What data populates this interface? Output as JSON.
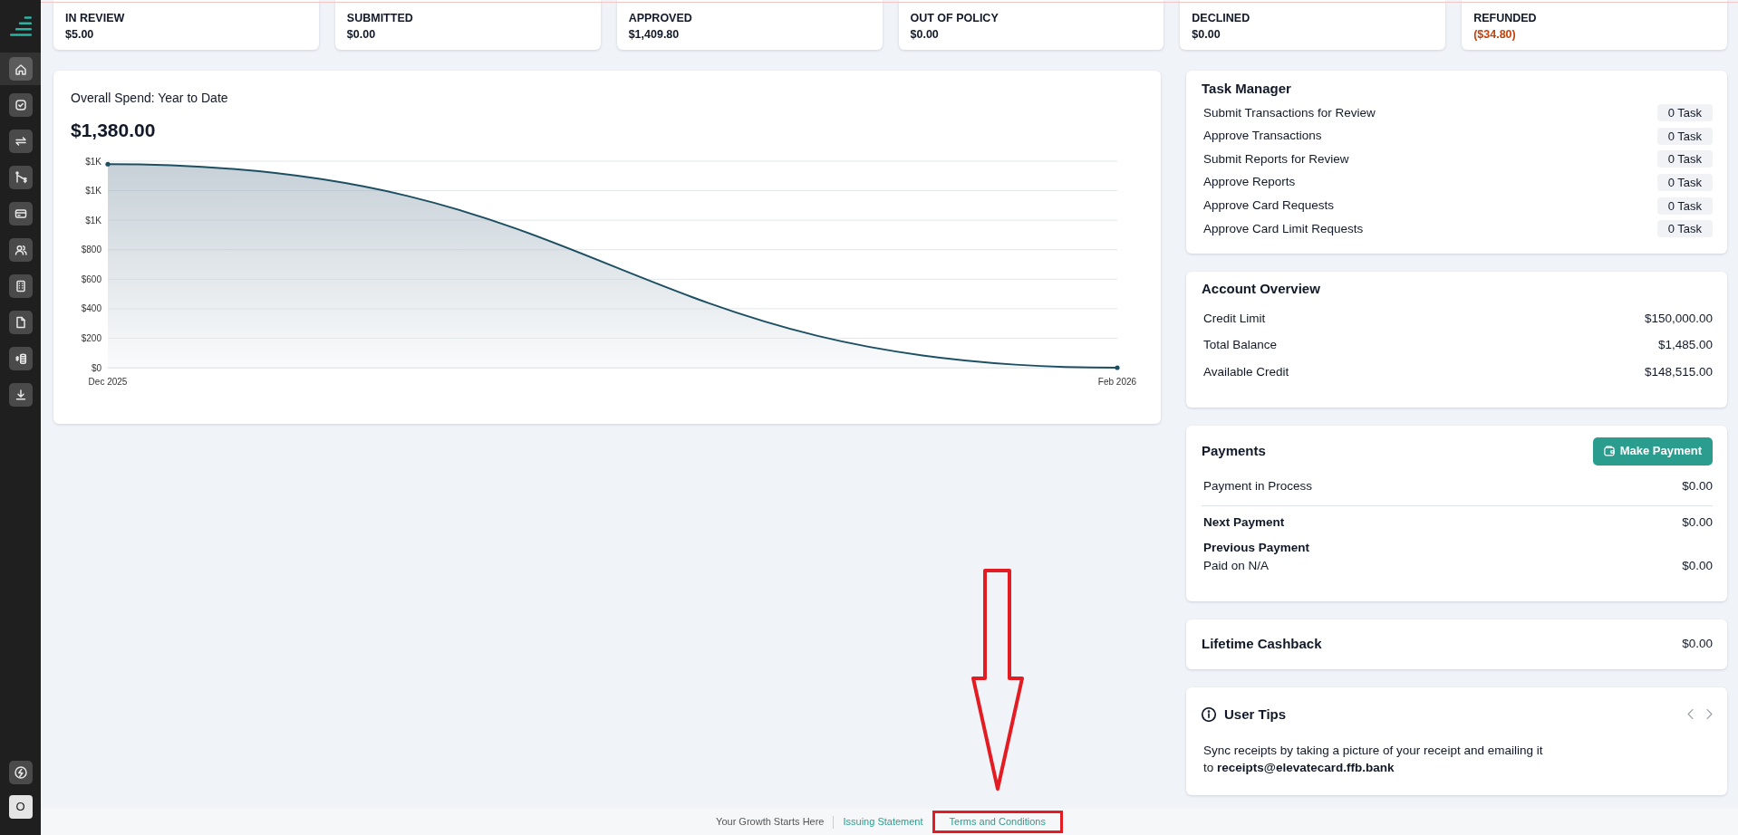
{
  "sidebar": {
    "items": [
      {
        "kind": "home",
        "selected": true
      },
      {
        "kind": "check",
        "selected": false
      },
      {
        "kind": "transfer",
        "selected": false
      },
      {
        "kind": "route",
        "selected": false
      },
      {
        "kind": "card",
        "selected": false
      },
      {
        "kind": "users",
        "selected": false
      },
      {
        "kind": "building",
        "selected": false
      },
      {
        "kind": "file",
        "selected": false
      },
      {
        "kind": "coins",
        "selected": false
      },
      {
        "kind": "download",
        "selected": false
      }
    ],
    "bottom_items": [
      {
        "kind": "bolt"
      }
    ],
    "avatar": {
      "initial": "O"
    }
  },
  "status_cards": [
    {
      "label": "IN REVIEW",
      "amount": "$5.00",
      "negative": false
    },
    {
      "label": "SUBMITTED",
      "amount": "$0.00",
      "negative": false
    },
    {
      "label": "APPROVED",
      "amount": "$1,409.80",
      "negative": false
    },
    {
      "label": "OUT OF POLICY",
      "amount": "$0.00",
      "negative": false
    },
    {
      "label": "DECLINED",
      "amount": "$0.00",
      "negative": false
    },
    {
      "label": "REFUNDED",
      "amount": "($34.80)",
      "negative": true
    }
  ],
  "spend_chart": {
    "title": "Overall Spend: Year to Date",
    "total": "$1,380.00",
    "chart_data": {
      "type": "area",
      "categories": [
        "Dec 2025",
        "Feb 2026"
      ],
      "series": [
        {
          "color": "#1d4f63",
          "values": [
            1380,
            0
          ]
        }
      ],
      "ylim": [
        0,
        1400
      ],
      "yticks": [
        {
          "value": 0,
          "label": "$0"
        },
        {
          "value": 200,
          "label": "$200"
        },
        {
          "value": 400,
          "label": "$400"
        },
        {
          "value": 600,
          "label": "$600"
        },
        {
          "value": 800,
          "label": "$800"
        },
        {
          "value": 1000,
          "label": "$1K"
        },
        {
          "value": 1200,
          "label": "$1K"
        },
        {
          "value": 1400,
          "label": "$1K"
        }
      ]
    }
  },
  "task_manager": {
    "title": "Task Manager",
    "tasks": [
      {
        "label": "Submit Transactions for Review",
        "count": "0 Task"
      },
      {
        "label": "Approve Transactions",
        "count": "0 Task"
      },
      {
        "label": "Submit Reports for Review",
        "count": "0 Task"
      },
      {
        "label": "Approve Reports",
        "count": "0 Task"
      },
      {
        "label": "Approve Card Requests",
        "count": "0 Task"
      },
      {
        "label": "Approve Card Limit Requests",
        "count": "0 Task"
      }
    ]
  },
  "account_overview": {
    "title": "Account Overview",
    "rows": [
      {
        "label": "Credit Limit",
        "value": "$150,000.00"
      },
      {
        "label": "Total Balance",
        "value": "$1,485.00"
      },
      {
        "label": "Available Credit",
        "value": "$148,515.00"
      }
    ]
  },
  "payments": {
    "title": "Payments",
    "button": "Make Payment",
    "rows": [
      {
        "kind": "process",
        "label": "Payment in Process",
        "value": "$0.00"
      },
      {
        "kind": "next",
        "label": "Next Payment",
        "value": "$0.00"
      },
      {
        "kind": "previous",
        "label": "Previous Payment",
        "note": "Paid on N/A",
        "value": "$0.00"
      }
    ]
  },
  "lifetime_cashback": {
    "label": "Lifetime Cashback",
    "value": "$0.00"
  },
  "user_tips": {
    "title": "User Tips",
    "text": "Sync receipts by taking a picture of your receipt and emailing it\nto **receipts@elevatecard.ffb.bank**"
  },
  "footer": {
    "items": [
      {
        "kind": "text",
        "label": "Your Growth Starts Here",
        "highlighted": false
      },
      {
        "kind": "link",
        "label": "Issuing Statement",
        "highlighted": false
      },
      {
        "kind": "link",
        "label": "Terms and Conditions",
        "highlighted": true
      }
    ]
  },
  "annotations": [
    {
      "kind": "arrow"
    }
  ]
}
